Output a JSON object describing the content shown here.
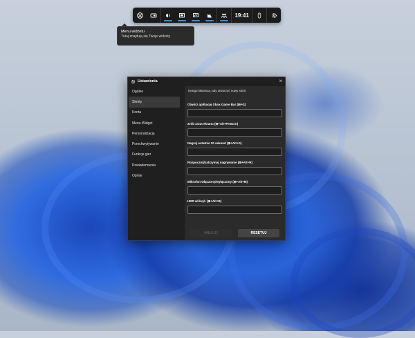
{
  "gamebar": {
    "time": "19:41",
    "buttons": [
      {
        "icon": "xbox-icon"
      },
      {
        "icon": "widget-menu-icon"
      },
      {
        "icon": "audio-icon"
      },
      {
        "icon": "capture-icon"
      },
      {
        "icon": "performance-icon"
      },
      {
        "icon": "resources-icon"
      },
      {
        "icon": "xbox-social-icon"
      },
      {
        "icon": "mouse-icon"
      },
      {
        "icon": "settings-icon"
      }
    ]
  },
  "tooltip": {
    "title": "Menu widżetu",
    "subtitle": "Tutaj znajdują się Twoje widżety"
  },
  "window": {
    "title": "Ustawienia",
    "close_label": "×",
    "nav": [
      {
        "label": "Ogólne"
      },
      {
        "label": "Skróty"
      },
      {
        "label": "Konta"
      },
      {
        "label": "Menu Widget"
      },
      {
        "label": "Personalizacja"
      },
      {
        "label": "Przechwytywanie"
      },
      {
        "label": "Funkcje gier"
      },
      {
        "label": "Powiadomienia"
      },
      {
        "label": "Opinie"
      }
    ],
    "selected_nav": "Skróty",
    "intro": "innego klawisza, aby utworzyć nowy skrót",
    "shortcuts": [
      {
        "label": "Otwórz aplikację Xbox Game Bar (⊞+G)",
        "value": ""
      },
      {
        "label": "Zrób zrzut ekranu (⊞+Alt+PrtScrn)",
        "value": ""
      },
      {
        "label": "Nagraj ostatnie 30 sekund (⊞+Alt+G)",
        "value": ""
      },
      {
        "label": "Rozpocznij/zatrzymaj nagrywanie (⊞+Alt+R)",
        "value": ""
      },
      {
        "label": "Mikrofon włączony/wyłączony (⊞+Alt+M)",
        "value": ""
      },
      {
        "label": "HDR wł./wył. (⊞+Alt+B)",
        "value": ""
      }
    ],
    "cancel_label": "ANULUJ",
    "reset_label": "RESETUJ"
  }
}
